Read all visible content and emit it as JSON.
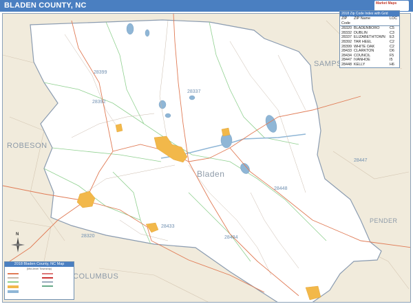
{
  "header": {
    "title": "BLADEN COUNTY, NC",
    "logo_text": "Market Maps"
  },
  "map": {
    "labels": {
      "county": "Bladen",
      "neighbors": [
        "ROBESON",
        "SAMPSON",
        "PENDER",
        "COLUMBUS"
      ]
    },
    "zip_labels": [
      "28399",
      "28337",
      "28392",
      "28448",
      "28447",
      "28433",
      "28434",
      "28320"
    ],
    "colors": {
      "header_bar": "#4a7fc1",
      "county_fill": "#ffffff",
      "outside_fill": "#f1ebdc",
      "urban_area": "#f2b84a",
      "water": "#8fb6d6",
      "highway": "#e07a54",
      "zip_boundary": "#8fd08f",
      "roads": "#c8b9aa"
    }
  },
  "zip_table": {
    "header": "2018 Zip Code Index with Grid Location",
    "columns": [
      "ZIP Code",
      "ZIP Name",
      "LOC"
    ],
    "rows": [
      [
        "28320",
        "BLADENBORO",
        "C5"
      ],
      [
        "28332",
        "DUBLIN",
        "C3"
      ],
      [
        "28337",
        "ELIZABETHTOWN",
        "E3"
      ],
      [
        "28392",
        "TAR HEEL",
        "C2"
      ],
      [
        "28399",
        "WHITE OAK",
        "C2"
      ],
      [
        "28433",
        "CLARKTON",
        "D6"
      ],
      [
        "28434",
        "COUNCIL",
        "F5"
      ],
      [
        "28447",
        "IVANHOE",
        "I5"
      ],
      [
        "28448",
        "KELLY",
        "H6"
      ]
    ]
  },
  "map_legend": {
    "title": "2018 Bladen County, NC Map",
    "subtitle": "(Mid-level Township)"
  },
  "compass": {
    "north_label": "N"
  }
}
